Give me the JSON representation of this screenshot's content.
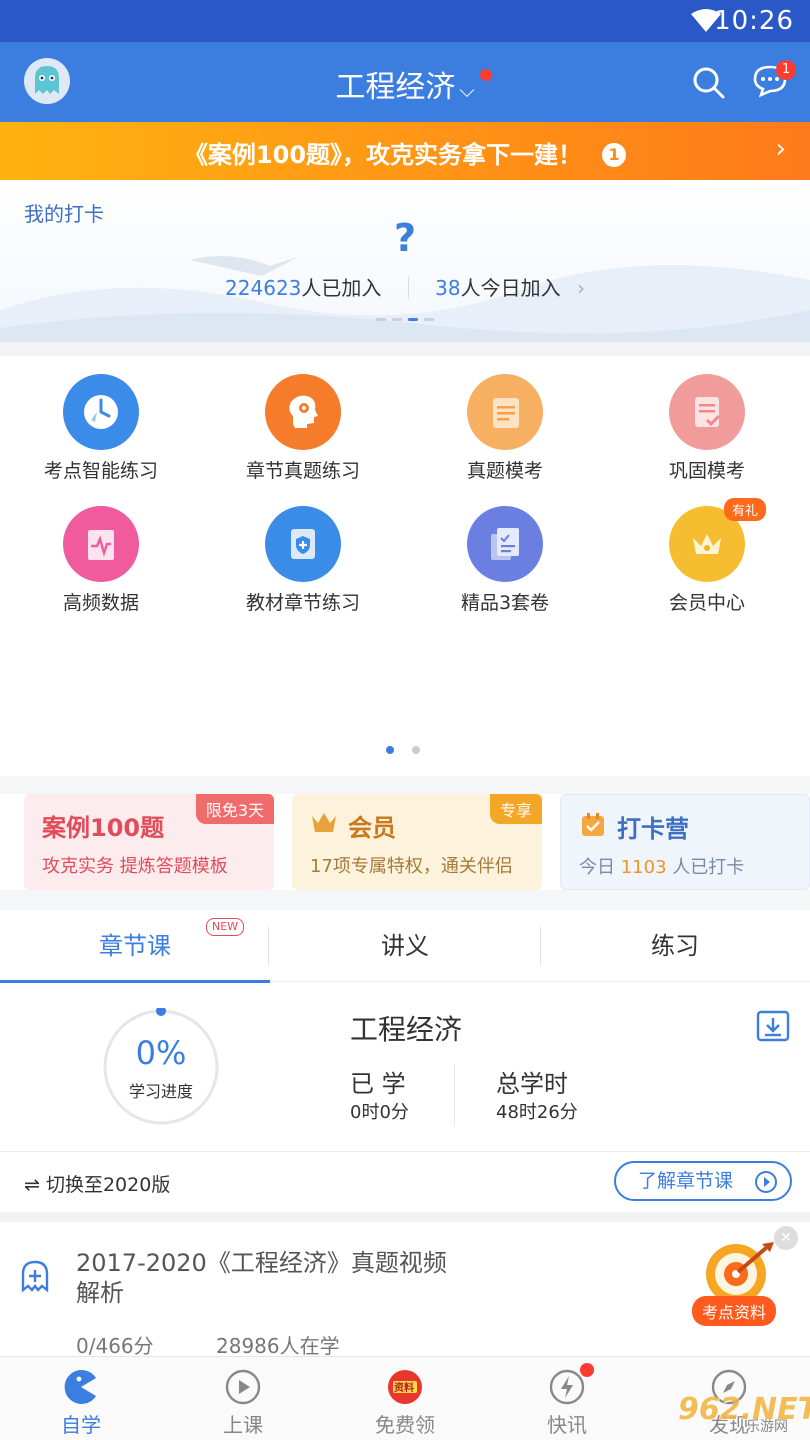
{
  "status": {
    "time": "10:26"
  },
  "header": {
    "title": "工程经济",
    "caret": "⌵",
    "message_count": "1"
  },
  "banner": {
    "text": "《案例100题》，攻克实务拿下一建！",
    "badge": "1",
    "arrow": "›"
  },
  "checkin": {
    "label": "我的打卡",
    "icon_text": "?",
    "joined_count": "224623",
    "joined_label": "人已加入",
    "today_count": "38",
    "today_label": "人今日加入",
    "arrow": "›"
  },
  "grid": {
    "items": [
      {
        "label": "考点智能练习",
        "icon": "clock-icon",
        "color": "#3a8ce8"
      },
      {
        "label": "章节真题练习",
        "icon": "brain-gear-icon",
        "color": "#f47c2a"
      },
      {
        "label": "真题模考",
        "icon": "document-icon",
        "color": "#f4a14a"
      },
      {
        "label": "巩固模考",
        "icon": "checklist-icon",
        "color": "#f08a8a"
      },
      {
        "label": "高频数据",
        "icon": "pulse-chart-icon",
        "color": "#ef5b9d"
      },
      {
        "label": "教材章节练习",
        "icon": "book-shield-icon",
        "color": "#3a8ce8"
      },
      {
        "label": "精品3套卷",
        "icon": "papers-icon",
        "color": "#6a7fe0"
      },
      {
        "label": "会员中心",
        "icon": "crown-icon",
        "color": "#f4b32a",
        "tag": "有礼"
      }
    ]
  },
  "cards": [
    {
      "title": "案例100题",
      "subtitle": "攻克实务 提炼答题模板",
      "badge": "限免3天"
    },
    {
      "title": "会员",
      "subtitle": "17项专属特权，通关伴侣",
      "badge": "专享"
    },
    {
      "title": "打卡营",
      "subtitle_prefix": "今日",
      "subtitle_count": "1103",
      "subtitle_suffix": "人已打卡"
    }
  ],
  "tabs": [
    {
      "label": "章节课",
      "tag": "NEW"
    },
    {
      "label": "讲义"
    },
    {
      "label": "练习"
    }
  ],
  "progress": {
    "percent": "0%",
    "percent_value": 0,
    "percent_label": "学习进度",
    "course_title": "工程经济",
    "learned_label": "已 学",
    "learned_value": "0时0分",
    "total_label": "总学时",
    "total_value": "48时26分"
  },
  "switch": {
    "icon": "⇌",
    "label": "切换至2020版",
    "button": "了解章节课"
  },
  "course": {
    "title": "2017-2020《工程经济》真题视频解析",
    "score": "0/466分",
    "learners": "28986人在学",
    "promo_tag": "考点资料",
    "close": "✕"
  },
  "bottomnav": [
    {
      "label": "自学",
      "icon": "pacman-icon",
      "active": true
    },
    {
      "label": "上课",
      "icon": "play-circle-icon"
    },
    {
      "label": "免费领",
      "icon": "gift-badge-icon",
      "badge_text": "资料"
    },
    {
      "label": "快讯",
      "icon": "lightning-circle-icon",
      "dot": true
    },
    {
      "label": "发现",
      "icon": "compass-icon"
    }
  ],
  "watermark": {
    "brand": "962.NET",
    "sub": "乐游网"
  }
}
